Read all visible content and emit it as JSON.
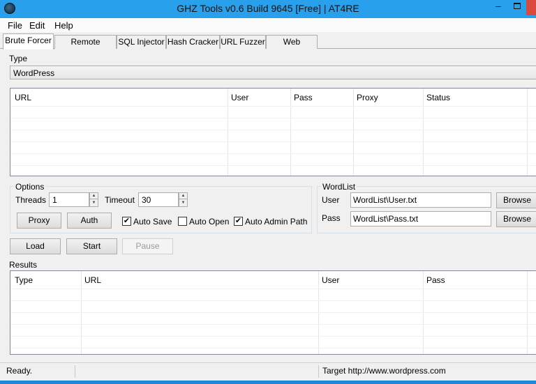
{
  "window": {
    "title": "GHZ Tools v0.6 Build 9645 [Free] | AT4RE",
    "minimize": "–",
    "close": ""
  },
  "menu": [
    "File",
    "Edit",
    "Help"
  ],
  "tabs": [
    "Brute Forcer",
    "Remote Exploits",
    "SQL Injector",
    "Hash Cracker",
    "URL Fuzzer",
    "Web Scanner"
  ],
  "brute": {
    "type_label": "Type",
    "type_value": "WordPress",
    "targets_columns": [
      "URL",
      "User",
      "Pass",
      "Proxy",
      "Status"
    ],
    "options": {
      "title": "Options",
      "threads_label": "Threads",
      "threads_value": "1",
      "timeout_label": "Timeout",
      "timeout_value": "30",
      "proxy_button": "Proxy",
      "auth_button": "Auth",
      "auto_save": {
        "label": "Auto Save",
        "checked": true,
        "mark": "✔"
      },
      "auto_open": {
        "label": "Auto Open",
        "checked": false,
        "mark": ""
      },
      "auto_admin": {
        "label": "Auto Admin Path",
        "checked": true,
        "mark": "✔"
      }
    },
    "wordlist": {
      "title": "WordList",
      "user_label": "User",
      "user_value": "WordList\\User.txt",
      "pass_label": "Pass",
      "pass_value": "WordList\\Pass.txt",
      "browse_label": "Browse"
    },
    "actions": {
      "load": "Load",
      "start": "Start",
      "pause": "Pause"
    },
    "results_label": "Results",
    "results_columns": [
      "Type",
      "URL",
      "User",
      "Pass"
    ]
  },
  "status": {
    "left": "Ready.",
    "target": "Target http://www.wordpress.com"
  }
}
